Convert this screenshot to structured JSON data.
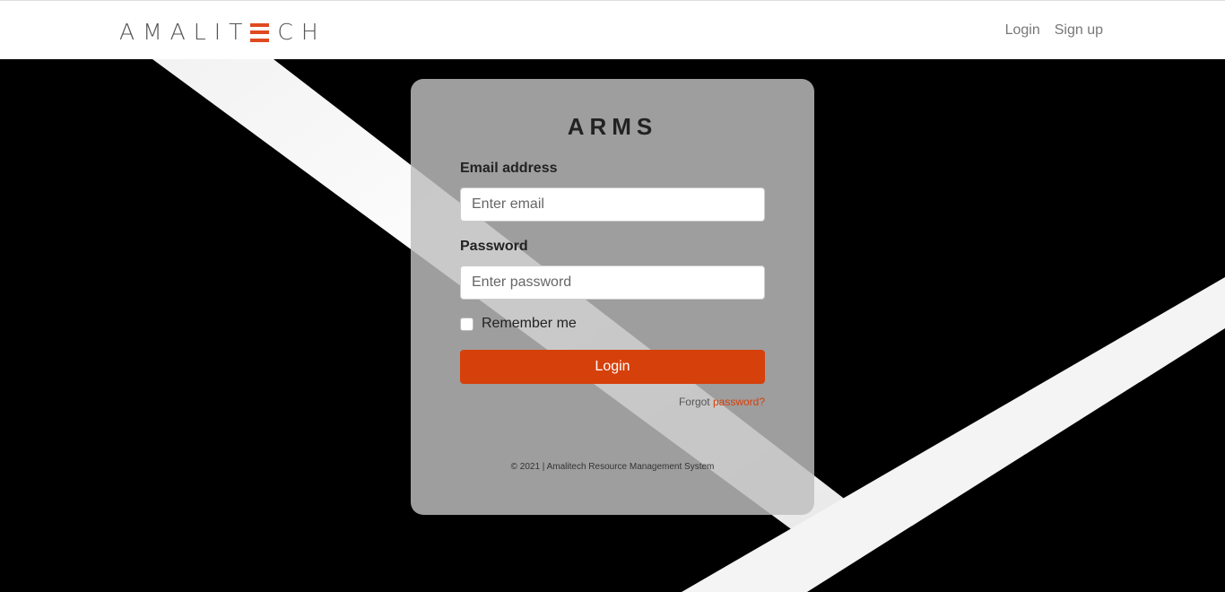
{
  "header": {
    "logo_text_left": "AMALIT",
    "logo_text_right": "CH",
    "nav": {
      "login": "Login",
      "signup": "Sign up"
    }
  },
  "card": {
    "title": "ARMS",
    "email": {
      "label": "Email address",
      "placeholder": "Enter email"
    },
    "password": {
      "label": "Password",
      "placeholder": "Enter password"
    },
    "remember": "Remember me",
    "login_button": "Login",
    "forgot_prefix": "Forgot",
    "forgot_link": "password?",
    "footer": "© 2021 | Amalitech Resource Management System"
  },
  "colors": {
    "accent": "#d6400b",
    "logo_mark": "#e0491f"
  }
}
